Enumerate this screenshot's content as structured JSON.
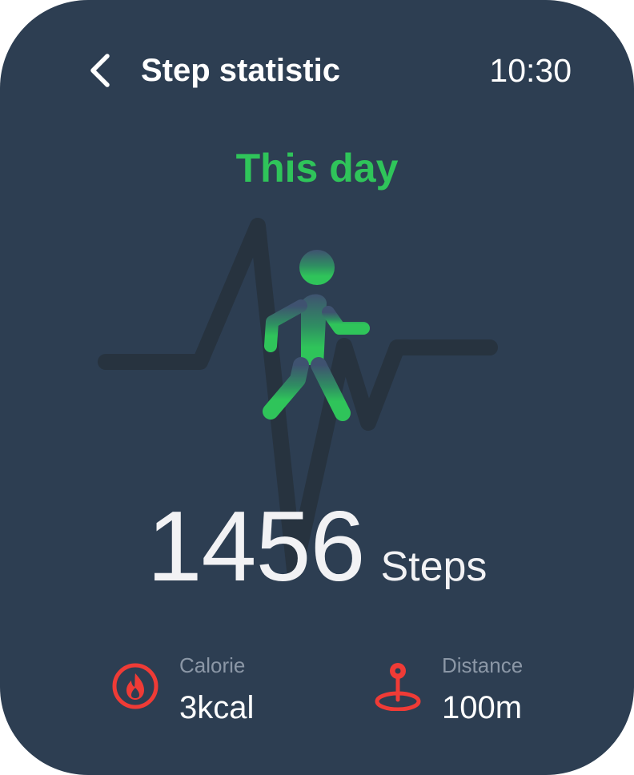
{
  "header": {
    "title": "Step statistic",
    "time": "10:30"
  },
  "period_label": "This day",
  "steps": {
    "count": "1456",
    "unit": "Steps"
  },
  "stats": {
    "calorie": {
      "label": "Calorie",
      "value": "3kcal",
      "icon": "flame-icon"
    },
    "distance": {
      "label": "Distance",
      "value": "100m",
      "icon": "location-pin-icon"
    }
  },
  "colors": {
    "background": "#2d3e52",
    "accent_green": "#2fc45a",
    "icon_red": "#ef3b36",
    "muted_text": "#8b97a6"
  },
  "icons": {
    "back": "chevron-left-icon",
    "activity": "walking-person-icon",
    "decoration": "heartbeat-line"
  }
}
